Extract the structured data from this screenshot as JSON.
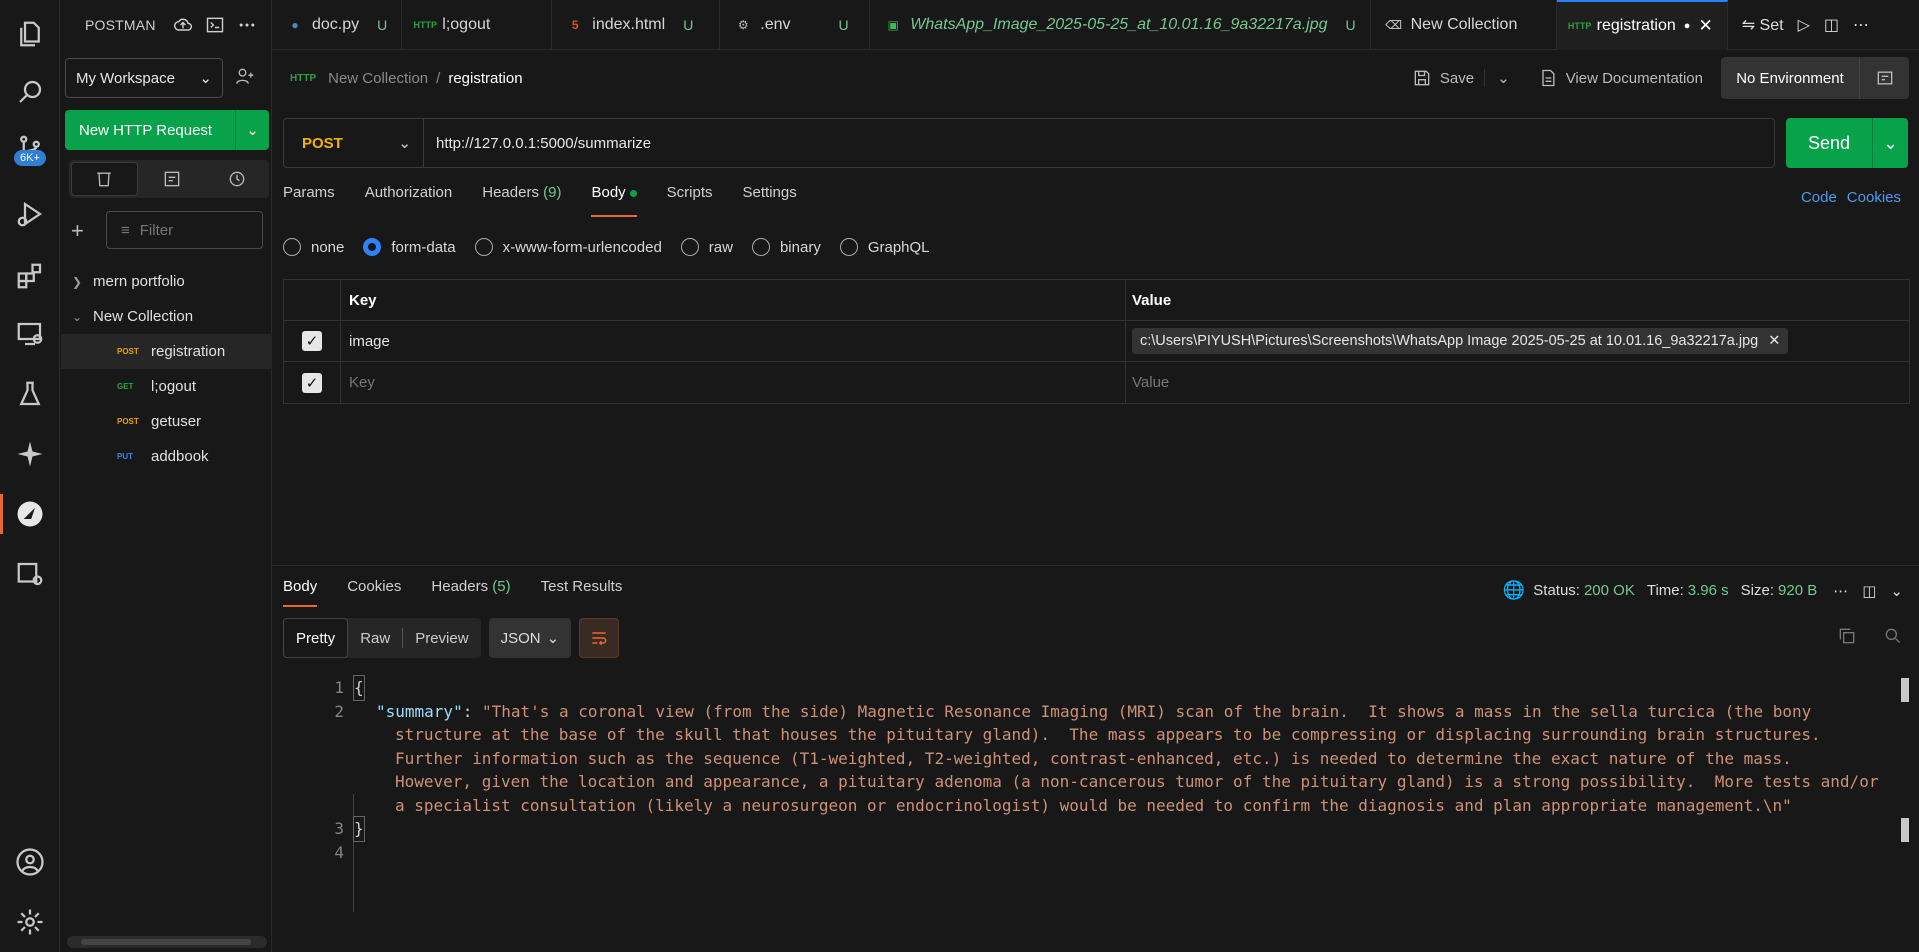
{
  "sidebar": {
    "app_name": "POSTMAN",
    "workspace": "My Workspace",
    "new_request": "New HTTP Request",
    "filter_placeholder": "Filter",
    "tree": [
      {
        "label": "mern portfolio"
      },
      {
        "label": "New Collection"
      }
    ],
    "requests": [
      {
        "method": "POST",
        "label": "registration"
      },
      {
        "method": "GET",
        "label": "l;ogout"
      },
      {
        "method": "POST",
        "label": "getuser"
      },
      {
        "method": "PUT",
        "label": "addbook"
      }
    ]
  },
  "activity": {
    "badge": "6K+"
  },
  "tabs": [
    {
      "label": "doc.py",
      "status": "U"
    },
    {
      "label": "l;ogout",
      "status": ""
    },
    {
      "label": "index.html",
      "status": "U"
    },
    {
      "label": ".env",
      "status": "U"
    },
    {
      "label": "WhatsApp_Image_2025-05-25_at_10.01.16_9a32217a.jpg",
      "status": "U"
    },
    {
      "label": "New Collection",
      "status": ""
    },
    {
      "label": "registration",
      "status": ""
    }
  ],
  "tab_extra": "Set",
  "breadcrumb": {
    "parent": "New Collection",
    "sep": "/",
    "current": "registration"
  },
  "toolbar": {
    "save": "Save",
    "view_doc": "View Documentation",
    "environment": "No Environment"
  },
  "request": {
    "method": "POST",
    "url": "http://127.0.0.1:5000/summarize",
    "send": "Send"
  },
  "req_tabs": {
    "params": "Params",
    "authorization": "Authorization",
    "headers": "Headers",
    "headers_count": "(9)",
    "body": "Body",
    "scripts": "Scripts",
    "settings": "Settings",
    "code": "Code",
    "cookies": "Cookies"
  },
  "body_modes": {
    "none": "none",
    "form_data": "form-data",
    "urlencoded": "x-www-form-urlencoded",
    "raw": "raw",
    "binary": "binary",
    "graphql": "GraphQL"
  },
  "kv": {
    "key_header": "Key",
    "value_header": "Value",
    "row_key": "image",
    "row_value": "c:\\Users\\PIYUSH\\Pictures\\Screenshots\\WhatsApp Image 2025-05-25 at 10.01.16_9a32217a.jpg",
    "key_placeholder": "Key",
    "value_placeholder": "Value"
  },
  "response": {
    "tabs": {
      "body": "Body",
      "cookies": "Cookies",
      "headers": "Headers",
      "headers_count": "(5)",
      "tests": "Test Results"
    },
    "status_label": "Status:",
    "status_value": "200 OK",
    "time_label": "Time:",
    "time_value": "3.96 s",
    "size_label": "Size:",
    "size_value": "920 B",
    "formats": {
      "pretty": "Pretty",
      "raw": "Raw",
      "preview": "Preview",
      "json": "JSON"
    },
    "lines": {
      "l1": "{",
      "key": "\"summary\"",
      "colon": ": ",
      "s1": "\"That's a coronal view (from the side) Magnetic Resonance Imaging (MRI) scan of the brain.  It shows a mass in the sella turcica (the bony",
      "s2": "structure at the base of the skull that houses the pituitary gland).  The mass appears to be compressing or displacing surrounding brain structures.",
      "s3": "Further information such as the sequence (T1-weighted, T2-weighted, contrast-enhanced, etc.) is needed to determine the exact nature of the mass.",
      "s4": "However, given the location and appearance, a pituitary adenoma (a non-cancerous tumor of the pituitary gland) is a strong possibility.  More tests and/or",
      "s5": "a specialist consultation (likely a neurosurgeon or endocrinologist) would be needed to confirm the diagnosis and plan appropriate management.\\n\"",
      "l3": "}",
      "n1": "1",
      "n2": "2",
      "n3": "3",
      "n4": "4"
    }
  }
}
